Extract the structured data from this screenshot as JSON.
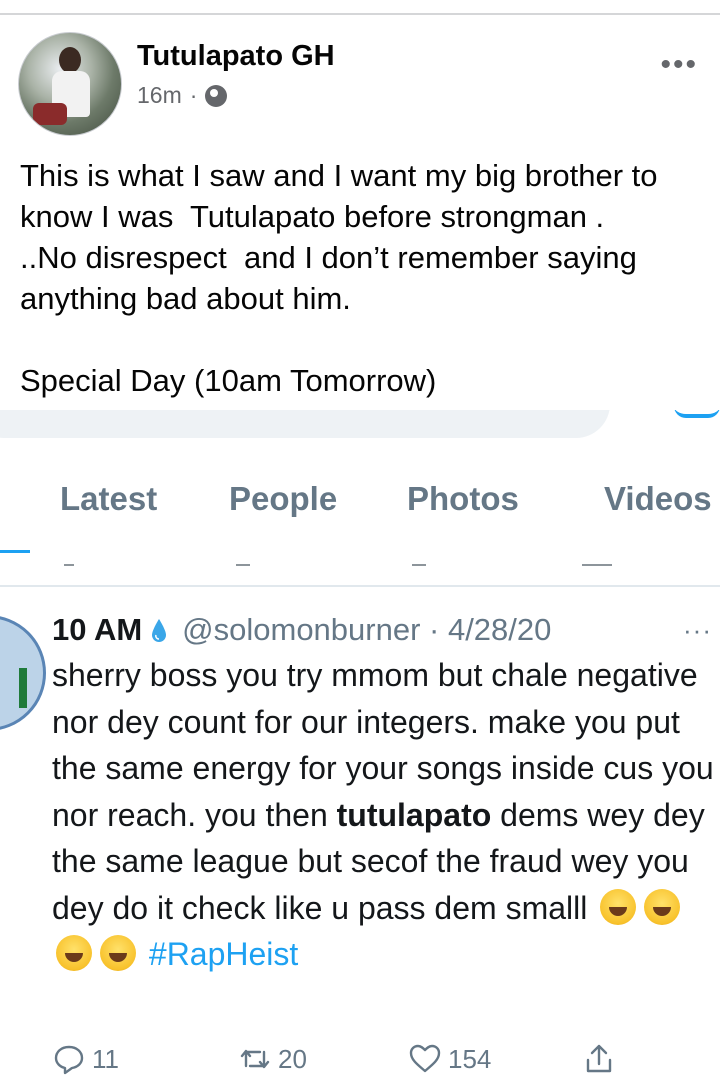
{
  "post": {
    "author": "Tutulapato GH",
    "time": "16m",
    "separator": "·",
    "text": "This is what I saw and I want my big brother to know I was  Tutulapato before strongman .\n..No disrespect  and I don’t remember saying anything bad about him.\n\nSpecial Day (10am Tomorrow)"
  },
  "screenshot": {
    "search_fragment": "tutulapato",
    "tabs": [
      "Latest",
      "People",
      "Photos",
      "Videos"
    ],
    "tweet": {
      "name": "10 AM",
      "handle": "@solomonburner · 4/28/20",
      "more": "···",
      "body_pre": "sherry boss you try mmom but chale negative nor dey count for our integers. make you put the same energy for your songs inside cus you nor reach. you then ",
      "highlight": "tutulapato",
      "body_post": " dems wey dey the same league but secof the fraud wey you dey do it check like u pass dem smalll",
      "hashtag": "#RapHeist",
      "replies": "11",
      "retweets": "20",
      "likes": "154"
    }
  },
  "colors": {
    "twitter_blue": "#1da1f2",
    "muted": "#657786"
  },
  "icons": [
    "globe-icon",
    "more-icon",
    "water-drop-icon",
    "reply-icon",
    "retweet-icon",
    "like-icon",
    "share-icon",
    "joy-emoji"
  ]
}
